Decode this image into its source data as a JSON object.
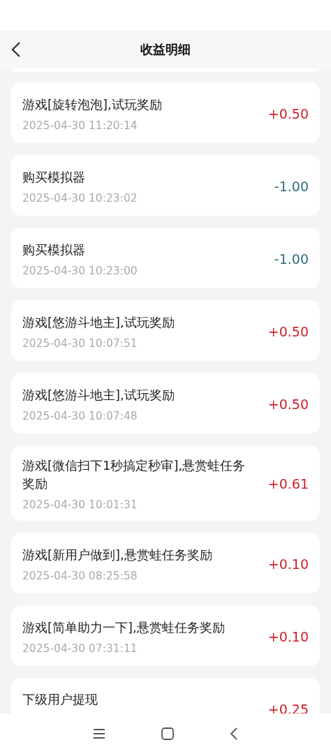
{
  "header": {
    "title": "收益明细"
  },
  "records": [
    {
      "title": "游戏[旋转泡泡],试玩奖励",
      "time": "2025-04-30 11:20:14",
      "amount": "+0.50",
      "kind": "income"
    },
    {
      "title": "购买模拟器",
      "time": "2025-04-30 10:23:02",
      "amount": "-1.00",
      "kind": "expense"
    },
    {
      "title": "购买模拟器",
      "time": "2025-04-30 10:23:00",
      "amount": "-1.00",
      "kind": "expense"
    },
    {
      "title": "游戏[悠游斗地主],试玩奖励",
      "time": "2025-04-30 10:07:51",
      "amount": "+0.50",
      "kind": "income"
    },
    {
      "title": "游戏[悠游斗地主],试玩奖励",
      "time": "2025-04-30 10:07:48",
      "amount": "+0.50",
      "kind": "income"
    },
    {
      "title": "游戏[微信扫下1秒搞定秒审],悬赏蛙任务奖励",
      "time": "2025-04-30 10:01:31",
      "amount": "+0.61",
      "kind": "income"
    },
    {
      "title": "游戏[新用户做到],悬赏蛙任务奖励",
      "time": "2025-04-30 08:25:58",
      "amount": "+0.10",
      "kind": "income"
    },
    {
      "title": "游戏[简单助力一下],悬赏蛙任务奖励",
      "time": "2025-04-30 07:31:11",
      "amount": "+0.10",
      "kind": "income"
    },
    {
      "title": "下级用户提现",
      "amount": "+0.25",
      "kind": "income"
    }
  ]
}
